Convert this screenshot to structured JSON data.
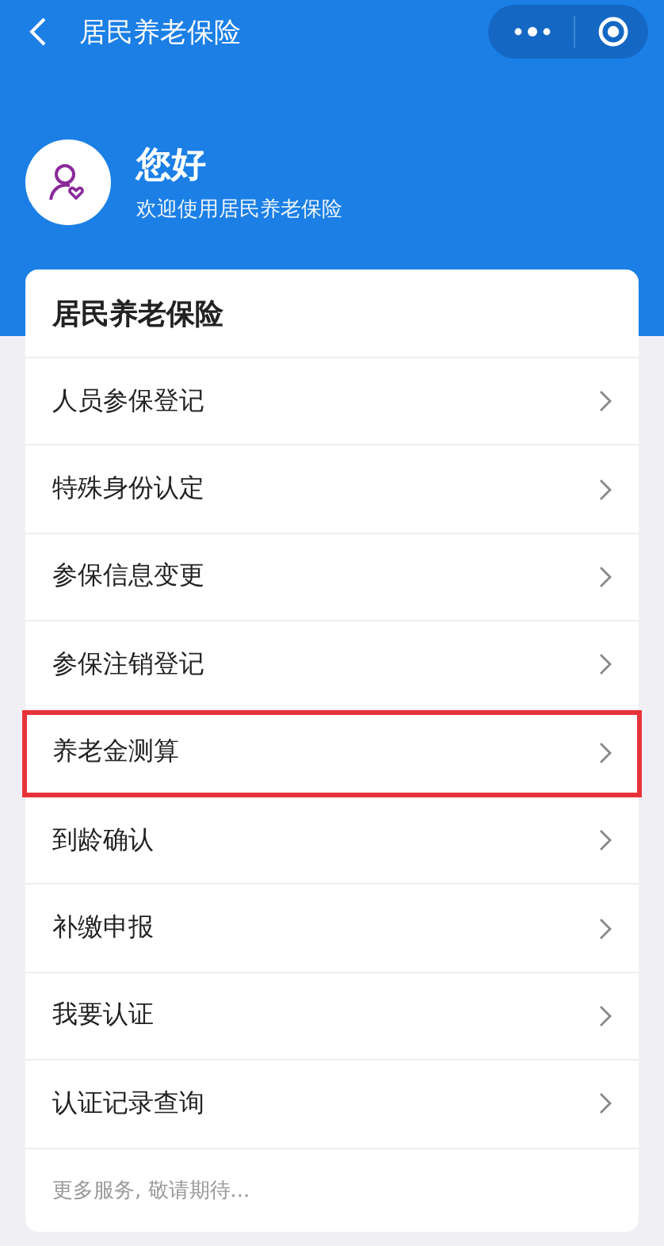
{
  "nav_bar": {
    "title": "居民养老保险"
  },
  "greeting": {
    "title": "您好",
    "subtitle": "欢迎使用居民养老保险"
  },
  "card": {
    "title": "居民养老保险",
    "items": [
      {
        "label": "人员参保登记",
        "highlighted": false
      },
      {
        "label": "特殊身份认定",
        "highlighted": false
      },
      {
        "label": "参保信息变更",
        "highlighted": false
      },
      {
        "label": "参保注销登记",
        "highlighted": false
      },
      {
        "label": "养老金测算",
        "highlighted": true
      },
      {
        "label": "到龄确认",
        "highlighted": false
      },
      {
        "label": "补缴申报",
        "highlighted": false
      },
      {
        "label": "我要认证",
        "highlighted": false
      },
      {
        "label": "认证记录查询",
        "highlighted": false
      }
    ],
    "footer": "更多服务, 敬请期待..."
  }
}
